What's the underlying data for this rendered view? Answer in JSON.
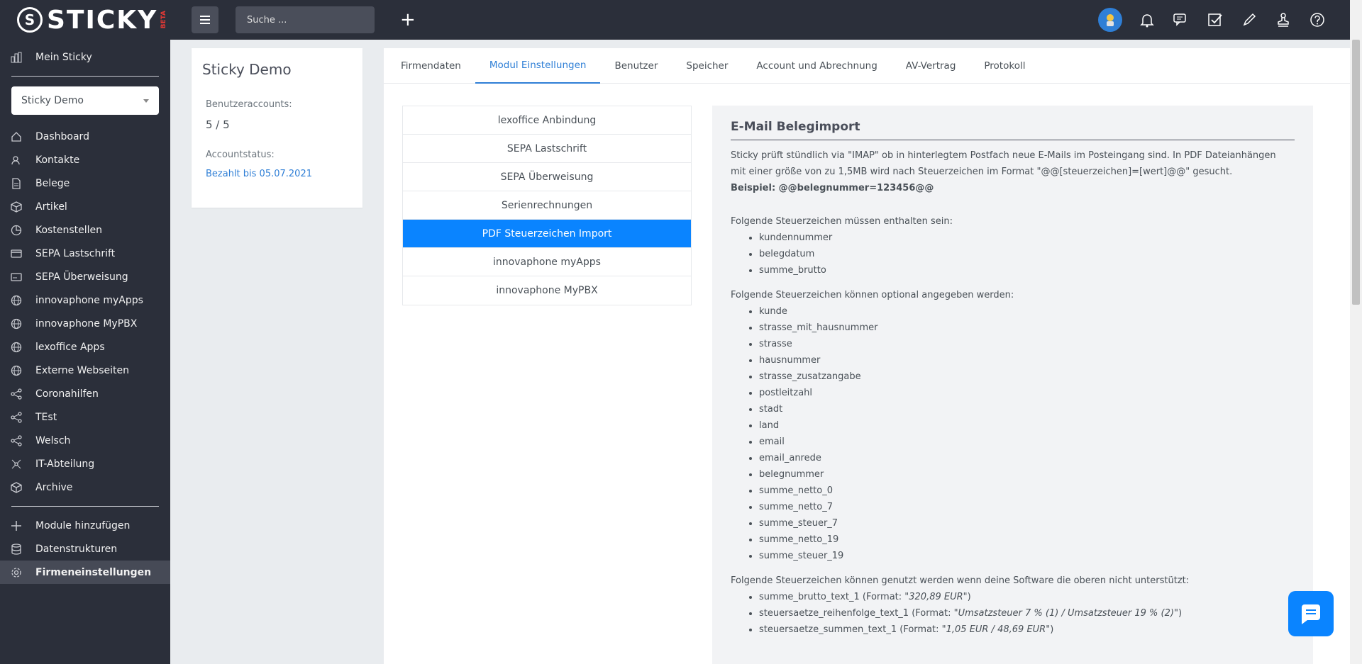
{
  "brand": {
    "logo_letter": "S",
    "name": "STICKY",
    "tag": "BETA"
  },
  "topbar": {
    "search_placeholder": "Suche ...",
    "add_label": "+"
  },
  "sidebar": {
    "top_item": "Mein Sticky",
    "company_select": "Sticky Demo",
    "items": [
      {
        "label": "Dashboard",
        "icon": "home-icon"
      },
      {
        "label": "Kontakte",
        "icon": "contacts-icon"
      },
      {
        "label": "Belege",
        "icon": "document-icon"
      },
      {
        "label": "Artikel",
        "icon": "box-icon"
      },
      {
        "label": "Kostenstellen",
        "icon": "pie-icon"
      },
      {
        "label": "SEPA Lastschrift",
        "icon": "card-icon"
      },
      {
        "label": "SEPA Überweisung",
        "icon": "transfer-icon"
      },
      {
        "label": "innovaphone myApps",
        "icon": "globe-icon"
      },
      {
        "label": "innovaphone MyPBX",
        "icon": "globe-icon"
      },
      {
        "label": "lexoffice Apps",
        "icon": "globe-icon"
      },
      {
        "label": "Externe Webseiten",
        "icon": "globe-icon"
      },
      {
        "label": "Coronahilfen",
        "icon": "share-icon"
      },
      {
        "label": "TEst",
        "icon": "share-icon"
      },
      {
        "label": "Welsch",
        "icon": "share-icon"
      },
      {
        "label": "IT-Abteilung",
        "icon": "network-icon"
      },
      {
        "label": "Archive",
        "icon": "box-icon"
      }
    ],
    "bottom_items": [
      {
        "label": "Module hinzufügen",
        "icon": "plus-icon"
      },
      {
        "label": "Datenstrukturen",
        "icon": "database-icon"
      },
      {
        "label": "Firmeneinstellungen",
        "icon": "gear-icon"
      }
    ]
  },
  "account": {
    "title": "Sticky Demo",
    "users_label": "Benutzeraccounts:",
    "users_value": "5 / 5",
    "status_label": "Accountstatus:",
    "status_value": "Bezahlt bis 05.07.2021"
  },
  "tabs": [
    "Firmendaten",
    "Modul Einstellungen",
    "Benutzer",
    "Speicher",
    "Account und Abrechnung",
    "AV-Vertrag",
    "Protokoll"
  ],
  "modules": [
    "lexoffice Anbindung",
    "SEPA Lastschrift",
    "SEPA Überweisung",
    "Serienrechnungen",
    "PDF Steuerzeichen Import",
    "innovaphone myApps",
    "innovaphone MyPBX"
  ],
  "detail": {
    "title": "E-Mail Belegimport",
    "intro1": "Sticky prüft stündlich via \"IMAP\" ob in hinterlegtem Postfach neue E-Mails im Posteingang sind. In PDF Dateianhängen",
    "intro2": "mit einer größe von zu 1,5MB wird nach Steuerzeichen im Format \"@@[steuerzeichen]=[wert]@@\" gesucht.",
    "example": "Beispiel: @@belegnummer=123456@@",
    "required_title": "Folgende Steuerzeichen müssen enthalten sein:",
    "required": [
      "kundennummer",
      "belegdatum",
      "summe_brutto"
    ],
    "optional_title": "Folgende Steuerzeichen können optional angegeben werden:",
    "optional": [
      "kunde",
      "strasse_mit_hausnummer",
      "strasse",
      "hausnummer",
      "strasse_zusatzangabe",
      "postleitzahl",
      "stadt",
      "land",
      "email",
      "email_anrede",
      "belegnummer",
      "summe_netto_0",
      "summe_netto_7",
      "summe_steuer_7",
      "summe_netto_19",
      "summe_steuer_19"
    ],
    "fallback_title": "Folgende Steuerzeichen können genutzt werden wenn deine Software die oberen nicht unterstützt:",
    "fallback": [
      {
        "name": "summe_brutto_text_1 (Format: \"",
        "fmt": "320,89 EUR",
        "end": "\")"
      },
      {
        "name": "steuersaetze_reihenfolge_text_1 (Format: \"",
        "fmt": "Umsatzsteuer 7 % (1) / Umsatzsteuer 19 % (2)",
        "end": "\")"
      },
      {
        "name": "steuersaetze_summen_text_1 (Format: \"",
        "fmt": "1,05 EUR / 48,69 EUR",
        "end": "\")"
      }
    ]
  },
  "colors": {
    "sidebar": "#2b2f3a",
    "accent": "#0a84ff",
    "link": "#2f7fd6"
  }
}
